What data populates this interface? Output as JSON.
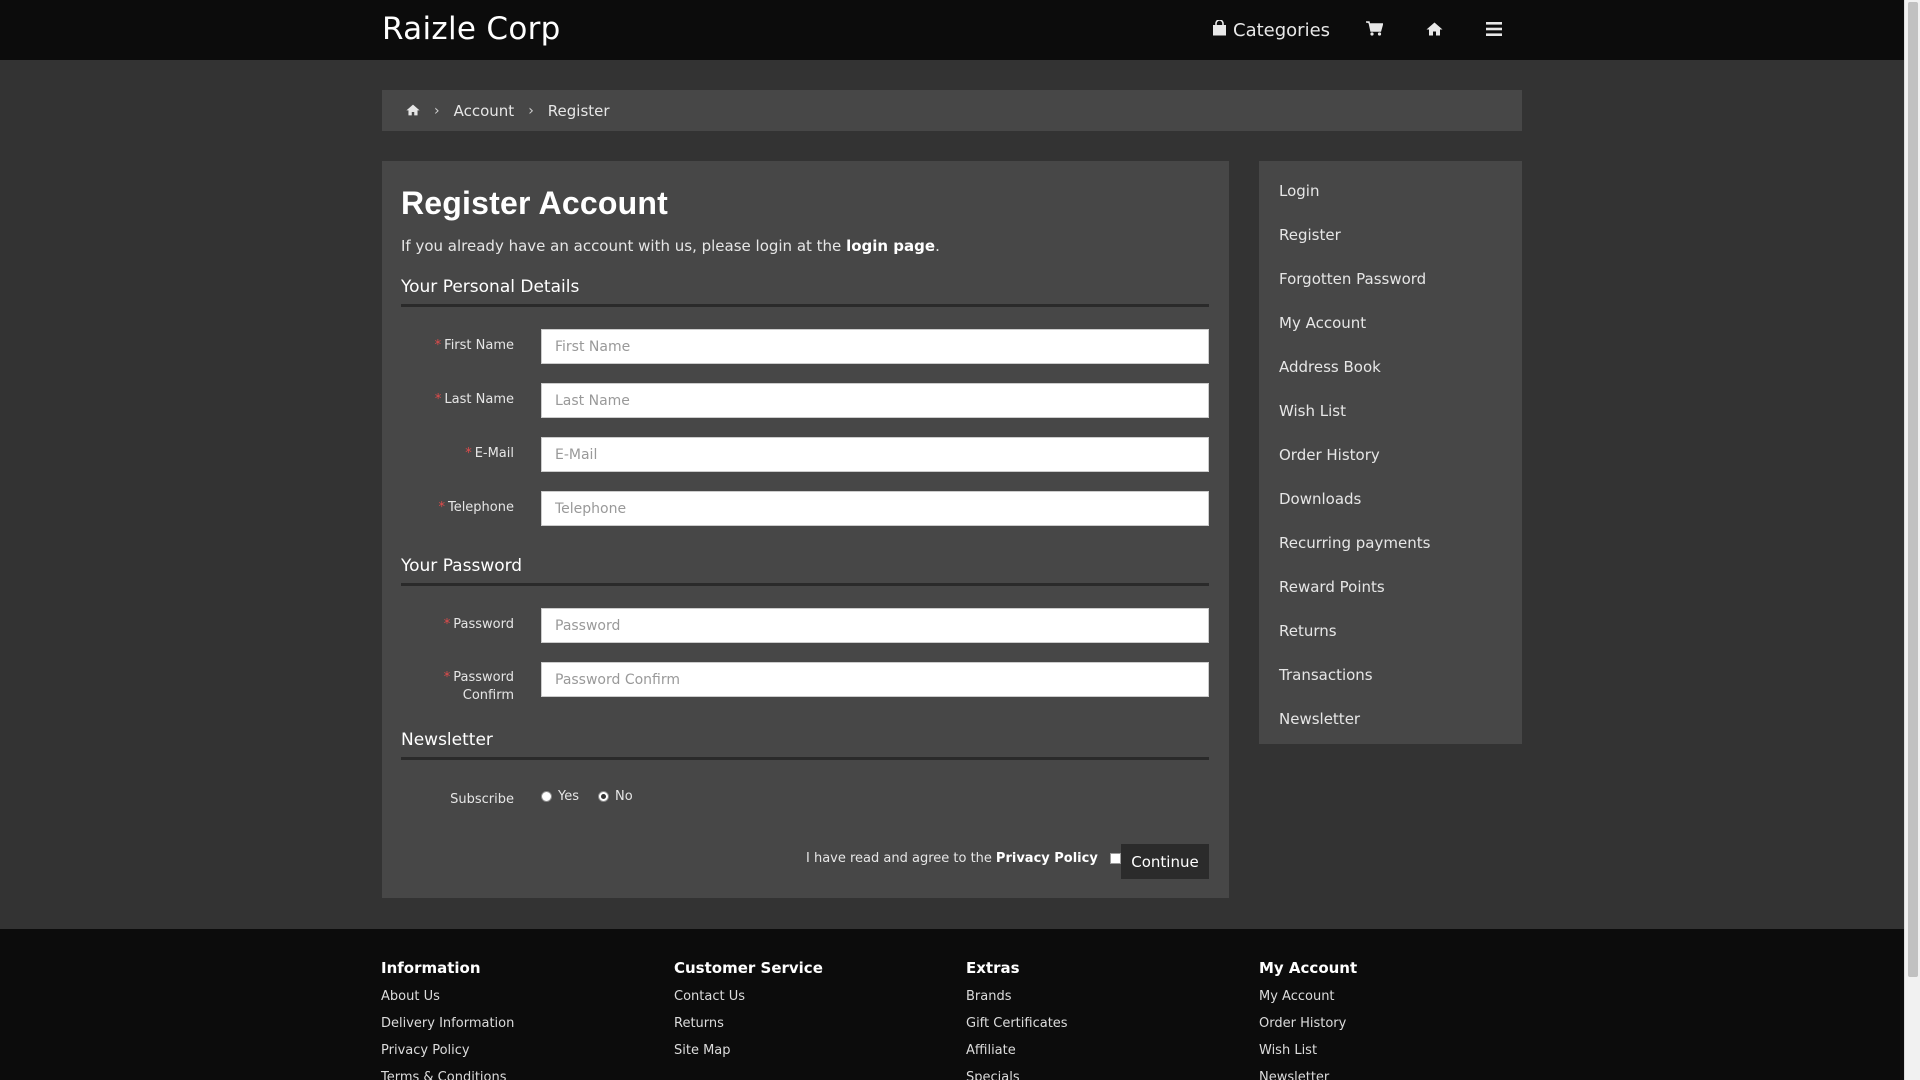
{
  "header": {
    "brand": "Raizle Corp",
    "categories_label": "Categories",
    "icons": [
      "shopping-bag-icon",
      "cart-icon",
      "home-icon",
      "menu-icon"
    ]
  },
  "breadcrumb": {
    "items": [
      "Account",
      "Register"
    ]
  },
  "main": {
    "title": "Register Account",
    "intro_prefix": "If you already have an account with us, please login at the ",
    "intro_link": "login page",
    "intro_suffix": ".",
    "sections": {
      "personal": "Your Personal Details",
      "password": "Your Password",
      "newsletter": "Newsletter"
    },
    "fields": {
      "first_name": {
        "label": "First Name",
        "placeholder": "First Name",
        "value": ""
      },
      "last_name": {
        "label": "Last Name",
        "placeholder": "Last Name",
        "value": ""
      },
      "email": {
        "label": "E-Mail",
        "placeholder": "E-Mail",
        "value": ""
      },
      "telephone": {
        "label": "Telephone",
        "placeholder": "Telephone",
        "value": ""
      },
      "password": {
        "label": "Password",
        "placeholder": "Password",
        "value": ""
      },
      "password_confirm": {
        "label_line1": "Password",
        "label_line2": "Confirm",
        "placeholder": "Password Confirm",
        "value": ""
      }
    },
    "required_mark": "*",
    "subscribe": {
      "label": "Subscribe",
      "yes": "Yes",
      "no": "No",
      "selected": "No"
    },
    "agree_text": "I have read and agree to the",
    "privacy_link": "Privacy Policy",
    "agree_checked": false,
    "continue_label": "Continue"
  },
  "sidebar": {
    "items": [
      "Login",
      "Register",
      "Forgotten Password",
      "My Account",
      "Address Book",
      "Wish List",
      "Order History",
      "Downloads",
      "Recurring payments",
      "Reward Points",
      "Returns",
      "Transactions",
      "Newsletter"
    ]
  },
  "footer": {
    "columns": [
      {
        "heading": "Information",
        "links": [
          "About Us",
          "Delivery Information",
          "Privacy Policy",
          "Terms & Conditions"
        ]
      },
      {
        "heading": "Customer Service",
        "links": [
          "Contact Us",
          "Returns",
          "Site Map"
        ]
      },
      {
        "heading": "Extras",
        "links": [
          "Brands",
          "Gift Certificates",
          "Affiliate",
          "Specials"
        ]
      },
      {
        "heading": "My Account",
        "links": [
          "My Account",
          "Order History",
          "Wish List",
          "Newsletter"
        ]
      }
    ]
  },
  "colors": {
    "page_bg": "#333333",
    "panel_bg": "#474747",
    "header_bg": "#0c0c0c",
    "required": "#e24c4c"
  }
}
